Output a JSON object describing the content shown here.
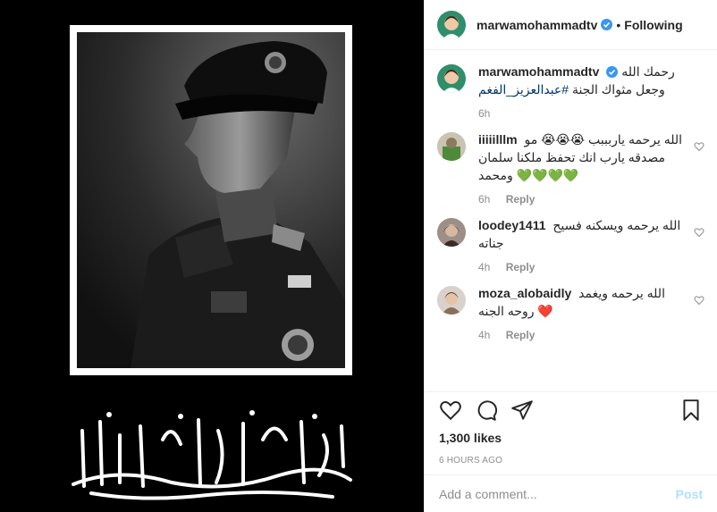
{
  "header": {
    "username": "marwamohammadtv",
    "separator": "•",
    "follow_label": "Following"
  },
  "caption": {
    "username": "marwamohammadtv",
    "text": "رحمك الله وجعل مثواك الجنة ",
    "hashtag": "#عبدالعزيز_الفغم",
    "time": "6h"
  },
  "comments": [
    {
      "username": "iiiiilllm",
      "text": "الله يرحمه ياربببب 😭😭😭 مو مصدقه يارب انك تحفظ ملكنا سلمان ومحمد 💚💚💚💚",
      "time": "6h",
      "reply": "Reply"
    },
    {
      "username": "loodey1411",
      "text": "الله يرحمه ويسكنه فسيح جناته",
      "time": "4h",
      "reply": "Reply"
    },
    {
      "username": "moza_alobaidly",
      "text": "الله يرحمه ويغمد روحه الجنه ❤️",
      "time": "4h",
      "reply": "Reply"
    }
  ],
  "post": {
    "likes": "1,300 likes",
    "timestamp": "6 HOURS AGO",
    "calligraphy_text": "إنا لله وإنا إليه راجعون"
  },
  "composer": {
    "placeholder": "Add a comment...",
    "post_label": "Post"
  },
  "colors": {
    "verified": "#3897f0",
    "link": "#00376b",
    "muted": "#8e8e8e",
    "post_disabled": "#b2dffc"
  },
  "icons": [
    "verified-badge-icon",
    "heart-icon",
    "comment-icon",
    "share-icon",
    "bookmark-icon",
    "small-heart-icon"
  ]
}
